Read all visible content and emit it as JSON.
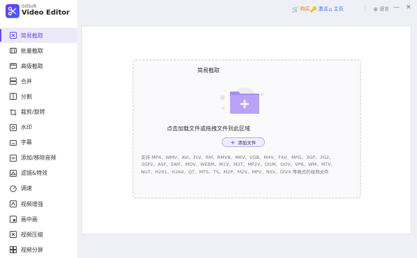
{
  "app": {
    "brand_small": "GiliSoft",
    "brand_name": "Video Editor"
  },
  "sidebar": {
    "items": [
      {
        "label": "简易截取",
        "icon": "scissors-icon",
        "active": true
      },
      {
        "label": "批量截取",
        "icon": "batch-cut-icon"
      },
      {
        "label": "高级截取",
        "icon": "advanced-cut-icon"
      },
      {
        "label": "合并",
        "icon": "merge-icon"
      },
      {
        "label": "分割",
        "icon": "split-icon"
      },
      {
        "label": "裁剪/旋转",
        "icon": "crop-rotate-icon"
      },
      {
        "label": "水印",
        "icon": "watermark-icon"
      },
      {
        "label": "字幕",
        "icon": "subtitle-icon"
      },
      {
        "label": "添加/移除音频",
        "icon": "audio-icon"
      },
      {
        "label": "滤镜&特效",
        "icon": "filter-icon"
      },
      {
        "label": "调速",
        "icon": "speed-icon"
      },
      {
        "label": "视频增强",
        "icon": "enhance-icon"
      },
      {
        "label": "画中画",
        "icon": "pip-icon"
      },
      {
        "label": "视频压缩",
        "icon": "compress-icon"
      },
      {
        "label": "视频分屏",
        "icon": "split-screen-icon"
      }
    ]
  },
  "topbar": {
    "buy": "购买",
    "activate": "激活",
    "home": "主页",
    "language": "语言"
  },
  "dropzone": {
    "title": "简易截取",
    "hint": "点击加载文件或拖拽文件到此区域",
    "add_button": "添加文件",
    "formats": "支持 MP4、WMV、AVI、FLV、RM、RMVB、MKV、VOB、M4V、F4V、MPG、3GP、3G2、3GP2、ASF、SWF、MOV、WEBM、M1V、M2T、MP2V、OGM、OGV、VP6、WM、MTV、NUT、H261、H264、QT、MTS、TS、M2P、M2V、MPV、NSV、DIVX 等格式的视频文件"
  },
  "colors": {
    "accent": "#6a4bf0",
    "buy": "#f07a0f",
    "link": "#3f72f4"
  }
}
